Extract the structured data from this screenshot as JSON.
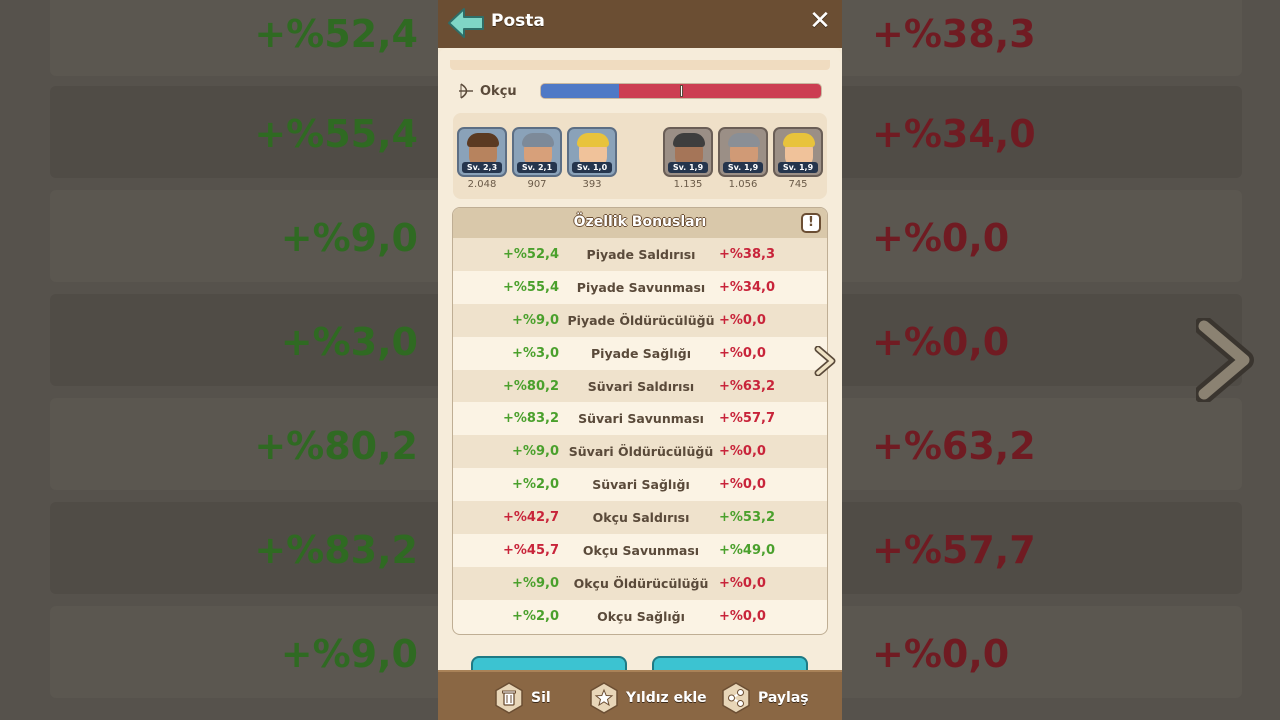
{
  "header": {
    "title": "Posta"
  },
  "unit": {
    "label": "Okçu",
    "ratio": 0.28
  },
  "heroes": {
    "left": [
      {
        "level": "Sv. 2,3",
        "count": "2.048"
      },
      {
        "level": "Sv. 2,1",
        "count": "907"
      },
      {
        "level": "Sv. 1,0",
        "count": "393"
      }
    ],
    "right": [
      {
        "level": "Sv. 1,9",
        "count": "1.135"
      },
      {
        "level": "Sv. 1,9",
        "count": "1.056"
      },
      {
        "level": "Sv. 1,9",
        "count": "745"
      }
    ]
  },
  "bonus": {
    "title": "Özellik Bonusları",
    "rows": [
      {
        "left": "+%52,4",
        "name": "Piyade Saldırısı",
        "right": "+%38,3",
        "left_pos": true,
        "right_pos": false
      },
      {
        "left": "+%55,4",
        "name": "Piyade Savunması",
        "right": "+%34,0",
        "left_pos": true,
        "right_pos": false
      },
      {
        "left": "+%9,0",
        "name": "Piyade Öldürücülüğü",
        "right": "+%0,0",
        "left_pos": true,
        "right_pos": false
      },
      {
        "left": "+%3,0",
        "name": "Piyade Sağlığı",
        "right": "+%0,0",
        "left_pos": true,
        "right_pos": false
      },
      {
        "left": "+%80,2",
        "name": "Süvari Saldırısı",
        "right": "+%63,2",
        "left_pos": true,
        "right_pos": false
      },
      {
        "left": "+%83,2",
        "name": "Süvari Savunması",
        "right": "+%57,7",
        "left_pos": true,
        "right_pos": false
      },
      {
        "left": "+%9,0",
        "name": "Süvari Öldürücülüğü",
        "right": "+%0,0",
        "left_pos": true,
        "right_pos": false
      },
      {
        "left": "+%2,0",
        "name": "Süvari Sağlığı",
        "right": "+%0,0",
        "left_pos": true,
        "right_pos": false
      },
      {
        "left": "+%42,7",
        "name": "Okçu Saldırısı",
        "right": "+%53,2",
        "left_pos": false,
        "right_pos": true
      },
      {
        "left": "+%45,7",
        "name": "Okçu Savunması",
        "right": "+%49,0",
        "left_pos": false,
        "right_pos": true
      },
      {
        "left": "+%9,0",
        "name": "Okçu Öldürücülüğü",
        "right": "+%0,0",
        "left_pos": true,
        "right_pos": false
      },
      {
        "left": "+%2,0",
        "name": "Okçu Sağlığı",
        "right": "+%0,0",
        "left_pos": true,
        "right_pos": false
      }
    ]
  },
  "footer": {
    "delete_label": "Sil",
    "star_label": "Yıldız ekle",
    "share_label": "Paylaş"
  },
  "background": {
    "left_values": [
      "+%52,4",
      "+%55,4",
      "+%9,0",
      "+%3,0",
      "+%80,2",
      "+%83,2",
      "+%9,0"
    ],
    "right_values": [
      "+%38,3",
      "+%34,0",
      "+%0,0",
      "+%0,0",
      "+%63,2",
      "+%57,7",
      "+%0,0"
    ]
  },
  "colors": {
    "positive": "#4aa02c",
    "negative": "#c8243a",
    "header": "#6b4e33",
    "accent": "#3cc3d1"
  }
}
